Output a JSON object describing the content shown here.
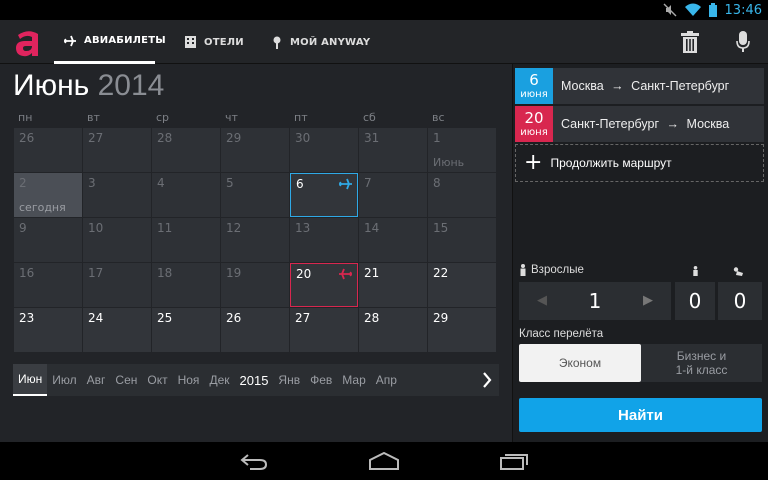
{
  "status_bar": {
    "time": "13:46"
  },
  "tabs": [
    {
      "label": "АВИАБИЛЕТЫ",
      "icon": "airplane-icon"
    },
    {
      "label": "ОТЕЛИ",
      "icon": "hotel-icon"
    },
    {
      "label": "МОЙ ANYWAY",
      "icon": "pin-icon"
    }
  ],
  "calendar": {
    "month": "Июнь",
    "year": "2014",
    "weekdays": [
      "пн",
      "вт",
      "ср",
      "чт",
      "пт",
      "сб",
      "вс"
    ],
    "days": [
      [
        "26",
        "27",
        "28",
        "29",
        "30",
        "31",
        "1"
      ],
      [
        "2",
        "3",
        "4",
        "5",
        "6",
        "7",
        "8"
      ],
      [
        "9",
        "10",
        "11",
        "12",
        "13",
        "14",
        "15"
      ],
      [
        "16",
        "17",
        "18",
        "19",
        "20",
        "21",
        "22"
      ],
      [
        "23",
        "24",
        "25",
        "26",
        "27",
        "28",
        "29"
      ]
    ],
    "sub_labels": {
      "june_first": "Июнь",
      "today": "сегодня"
    }
  },
  "month_bar": [
    "Июн",
    "Июл",
    "Авг",
    "Сен",
    "Окт",
    "Ноя",
    "Дек",
    "2015",
    "Янв",
    "Фев",
    "Мар",
    "Апр"
  ],
  "routes": [
    {
      "day": "6",
      "month": "июня",
      "from": "Москва",
      "to": "Санкт-Петербург",
      "color": "#1aa0e0"
    },
    {
      "day": "20",
      "month": "июня",
      "from": "Санкт-Петербург",
      "to": "Москва",
      "color": "#d8274f"
    }
  ],
  "continue_route": "Продолжить маршрут",
  "passengers": {
    "adults_label": "Взрослые",
    "adults": "1",
    "children": "0",
    "infants": "0"
  },
  "flight_class": {
    "label": "Класс перелёта",
    "economy": "Эконом",
    "business_line1": "Бизнес и",
    "business_line2": "1-й класс"
  },
  "find_button": "Найти",
  "colors": {
    "accent_blue": "#11a3e8",
    "accent_red": "#d8274f",
    "logo": "#e0245e"
  }
}
